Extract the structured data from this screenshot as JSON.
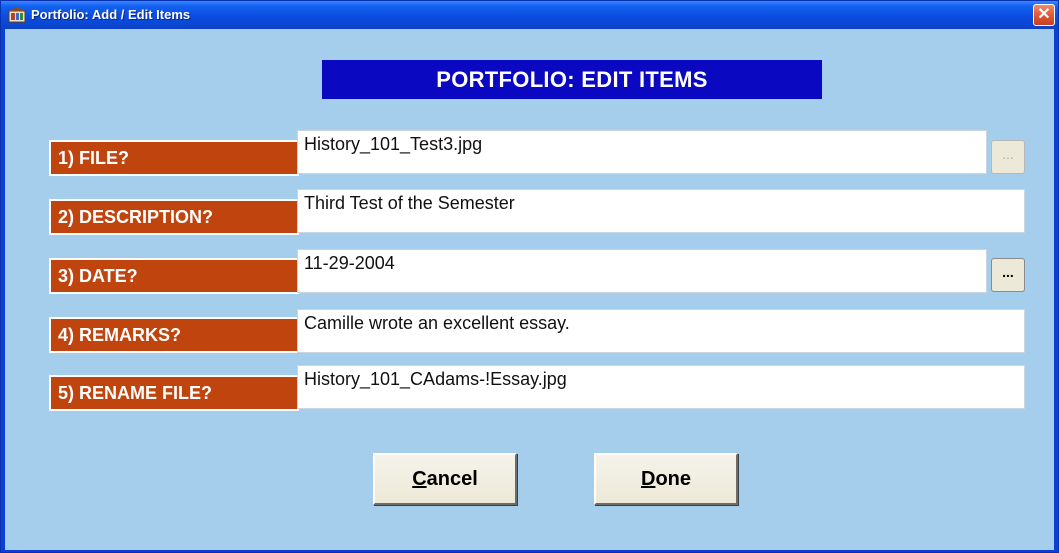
{
  "window": {
    "title": "Portfolio: Add / Edit Items",
    "close_label": "✕"
  },
  "header": {
    "title": "PORTFOLIO: EDIT ITEMS"
  },
  "fields": [
    {
      "label": "1) FILE?",
      "value": "History_101_Test3.jpg",
      "browse": {
        "label": "...",
        "enabled": false
      }
    },
    {
      "label": "2) DESCRIPTION?",
      "value": "Third Test of the Semester"
    },
    {
      "label": "3) DATE?",
      "value": "11-29-2004",
      "browse": {
        "label": "...",
        "enabled": true
      }
    },
    {
      "label": "4) REMARKS?",
      "value": "Camille wrote an excellent essay."
    },
    {
      "label": "5) RENAME FILE?",
      "value": "History_101_CAdams-!Essay.jpg"
    }
  ],
  "buttons": {
    "cancel": {
      "mnemonic": "C",
      "rest": "ancel"
    },
    "done": {
      "mnemonic": "D",
      "rest": "one"
    }
  },
  "icons": {
    "app": "portfolio-app-icon",
    "close": "close-icon"
  },
  "colors": {
    "titlebar": "#0a4de0",
    "background": "#a5cdec",
    "header_banner": "#0a08c0",
    "label_bg": "#c0440d",
    "button_face": "#ece9d8",
    "close_button": "#e05a36"
  }
}
